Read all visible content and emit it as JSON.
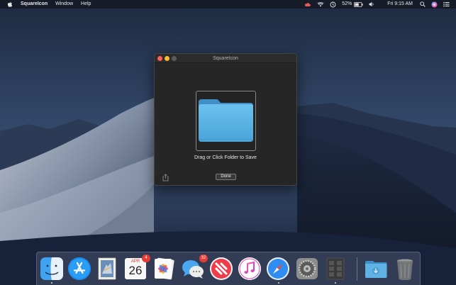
{
  "menubar": {
    "app_name": "SquareIcon",
    "menus": [
      "Window",
      "Help"
    ],
    "battery_percent": "52%",
    "clock": "Fri 9:15 AM",
    "status_icons": [
      "cloud-icon",
      "wifi-icon",
      "time-machine-icon",
      "battery-icon",
      "volume-icon",
      "spotlight-icon",
      "siri-icon",
      "notification-center-icon"
    ]
  },
  "window": {
    "title": "SquareIcon",
    "drop_label": "Drag or Click Folder to Save",
    "done_label": "Done",
    "folder_icon": "folder-icon",
    "share_icon": "share-icon"
  },
  "dock": {
    "calendar": {
      "month": "APR",
      "day": "26",
      "badge": "4"
    },
    "messages_badge": "32",
    "apps": [
      "finder",
      "app-store",
      "mail",
      "calendar",
      "photos",
      "messages",
      "news",
      "itunes",
      "safari",
      "system-preferences",
      "squareicon",
      "downloads-folder",
      "trash"
    ]
  },
  "colors": {
    "close": "#fc5f57",
    "minimize": "#fdbc2e",
    "zoom_disabled": "#5a5a5a",
    "folder": "#5fb3e4",
    "badge": "#e83a35"
  }
}
